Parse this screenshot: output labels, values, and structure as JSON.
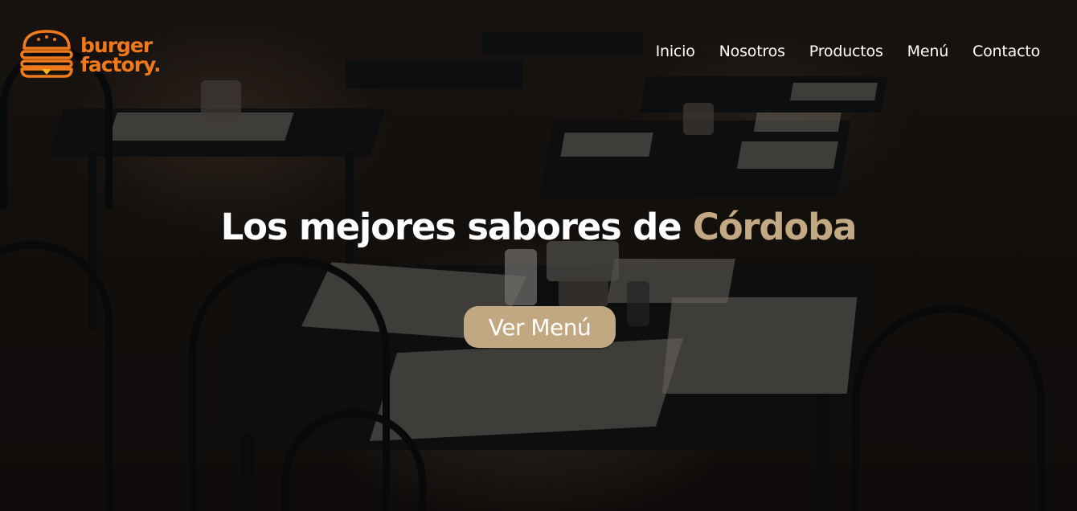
{
  "brand": {
    "line1": "burger",
    "line2": "factory.",
    "logo_icon": "burger-icon",
    "color": "#f07a1a"
  },
  "nav": {
    "items": [
      {
        "label": "Inicio"
      },
      {
        "label": "Nosotros"
      },
      {
        "label": "Productos"
      },
      {
        "label": "Menú"
      },
      {
        "label": "Contacto"
      }
    ]
  },
  "hero": {
    "headline_main": "Los mejores sabores de ",
    "headline_accent": "Córdoba",
    "accent_color": "#c3a884",
    "cta_label": "Ver Menú",
    "cta_color": "#c1a883"
  }
}
